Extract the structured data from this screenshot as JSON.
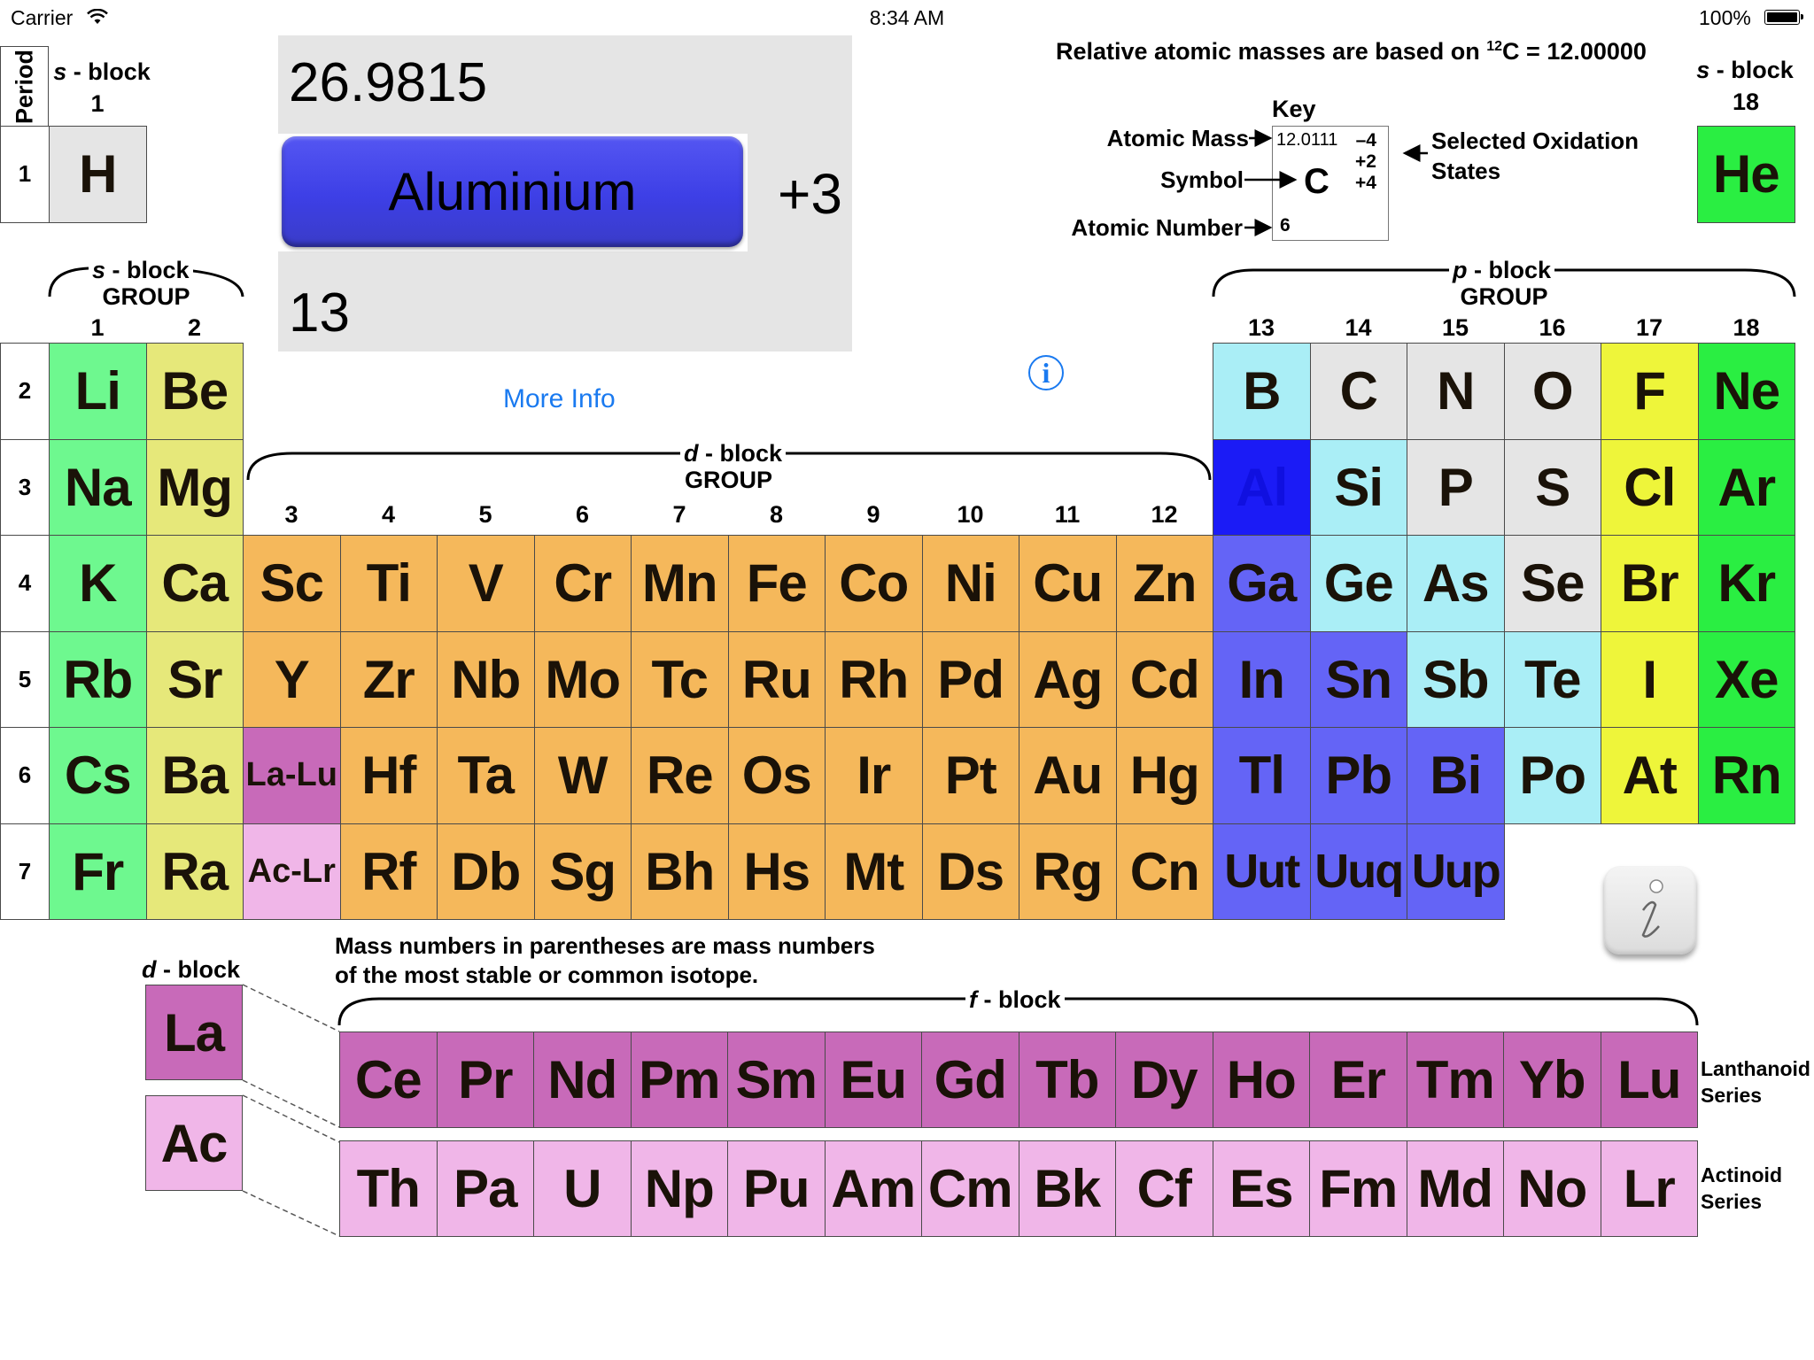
{
  "status_bar": {
    "carrier": "Carrier",
    "time": "8:34 AM",
    "battery": "100%"
  },
  "selected": {
    "atomic_mass": "26.9815",
    "name": "Aluminium",
    "oxidation": "+3",
    "atomic_number": "13",
    "more_info": "More Info"
  },
  "header_note": {
    "prefix": "Relative atomic masses are based on ",
    "sup": "12",
    "suffix": "C = 12.00000"
  },
  "key": {
    "title": "Key",
    "atomic_mass_label": "Atomic Mass",
    "symbol_label": "Symbol",
    "atomic_number_label": "Atomic Number",
    "ox_label_1": "Selected Oxidation",
    "ox_label_2": "States",
    "sample_mass": "12.0111",
    "sample_symbol": "C",
    "sample_number": "6",
    "sample_ox": [
      "–4",
      "+2",
      "+4"
    ]
  },
  "labels": {
    "period": "Period",
    "s_block": "s",
    "block_suffix": " - block",
    "p_block": "p",
    "d_block": "d",
    "f_block": "f",
    "group": "GROUP",
    "group_1": "1",
    "group_18": "18",
    "lanthanoid_1": "Lanthanoid",
    "actinoid_1": "Actinoid",
    "series": "Series",
    "mass_note_1": "Mass numbers in parentheses are mass numbers",
    "mass_note_2": "of the most stable or common isotope."
  },
  "periods": [
    "1",
    "2",
    "3",
    "4",
    "5",
    "6",
    "7"
  ],
  "group_numbers": [
    "1",
    "2",
    "3",
    "4",
    "5",
    "6",
    "7",
    "8",
    "9",
    "10",
    "11",
    "12",
    "13",
    "14",
    "15",
    "16",
    "17",
    "18"
  ],
  "colors": {
    "alkali": "#6ef88f",
    "alkaline": "#e6e87a",
    "transition": "#f5b85b",
    "metal": "#6464f6",
    "metalloid": "#aaeef6",
    "nonmetal": "#e5e5e5",
    "halogen": "#eef53a",
    "noble": "#2aee42",
    "lanthanoid": "#c86ab9",
    "actinoid": "#f0b6e8",
    "selected": "#1b1bf6",
    "hydrogen": "#e5e5e5"
  },
  "elements": [
    {
      "s": "H",
      "g": 1,
      "p": 1,
      "c": "hydrogen"
    },
    {
      "s": "He",
      "g": 18,
      "p": 1,
      "c": "noble"
    },
    {
      "s": "Li",
      "g": 1,
      "p": 2,
      "c": "alkali"
    },
    {
      "s": "Be",
      "g": 2,
      "p": 2,
      "c": "alkaline"
    },
    {
      "s": "B",
      "g": 13,
      "p": 2,
      "c": "metalloid"
    },
    {
      "s": "C",
      "g": 14,
      "p": 2,
      "c": "nonmetal"
    },
    {
      "s": "N",
      "g": 15,
      "p": 2,
      "c": "nonmetal"
    },
    {
      "s": "O",
      "g": 16,
      "p": 2,
      "c": "nonmetal"
    },
    {
      "s": "F",
      "g": 17,
      "p": 2,
      "c": "halogen"
    },
    {
      "s": "Ne",
      "g": 18,
      "p": 2,
      "c": "noble"
    },
    {
      "s": "Na",
      "g": 1,
      "p": 3,
      "c": "alkali"
    },
    {
      "s": "Mg",
      "g": 2,
      "p": 3,
      "c": "alkaline"
    },
    {
      "s": "Al",
      "g": 13,
      "p": 3,
      "c": "selected"
    },
    {
      "s": "Si",
      "g": 14,
      "p": 3,
      "c": "metalloid"
    },
    {
      "s": "P",
      "g": 15,
      "p": 3,
      "c": "nonmetal"
    },
    {
      "s": "S",
      "g": 16,
      "p": 3,
      "c": "nonmetal"
    },
    {
      "s": "Cl",
      "g": 17,
      "p": 3,
      "c": "halogen"
    },
    {
      "s": "Ar",
      "g": 18,
      "p": 3,
      "c": "noble"
    },
    {
      "s": "K",
      "g": 1,
      "p": 4,
      "c": "alkali"
    },
    {
      "s": "Ca",
      "g": 2,
      "p": 4,
      "c": "alkaline"
    },
    {
      "s": "Sc",
      "g": 3,
      "p": 4,
      "c": "transition"
    },
    {
      "s": "Ti",
      "g": 4,
      "p": 4,
      "c": "transition"
    },
    {
      "s": "V",
      "g": 5,
      "p": 4,
      "c": "transition"
    },
    {
      "s": "Cr",
      "g": 6,
      "p": 4,
      "c": "transition"
    },
    {
      "s": "Mn",
      "g": 7,
      "p": 4,
      "c": "transition"
    },
    {
      "s": "Fe",
      "g": 8,
      "p": 4,
      "c": "transition"
    },
    {
      "s": "Co",
      "g": 9,
      "p": 4,
      "c": "transition"
    },
    {
      "s": "Ni",
      "g": 10,
      "p": 4,
      "c": "transition"
    },
    {
      "s": "Cu",
      "g": 11,
      "p": 4,
      "c": "transition"
    },
    {
      "s": "Zn",
      "g": 12,
      "p": 4,
      "c": "transition"
    },
    {
      "s": "Ga",
      "g": 13,
      "p": 4,
      "c": "metal"
    },
    {
      "s": "Ge",
      "g": 14,
      "p": 4,
      "c": "metalloid"
    },
    {
      "s": "As",
      "g": 15,
      "p": 4,
      "c": "metalloid"
    },
    {
      "s": "Se",
      "g": 16,
      "p": 4,
      "c": "nonmetal"
    },
    {
      "s": "Br",
      "g": 17,
      "p": 4,
      "c": "halogen"
    },
    {
      "s": "Kr",
      "g": 18,
      "p": 4,
      "c": "noble"
    },
    {
      "s": "Rb",
      "g": 1,
      "p": 5,
      "c": "alkali"
    },
    {
      "s": "Sr",
      "g": 2,
      "p": 5,
      "c": "alkaline"
    },
    {
      "s": "Y",
      "g": 3,
      "p": 5,
      "c": "transition"
    },
    {
      "s": "Zr",
      "g": 4,
      "p": 5,
      "c": "transition"
    },
    {
      "s": "Nb",
      "g": 5,
      "p": 5,
      "c": "transition"
    },
    {
      "s": "Mo",
      "g": 6,
      "p": 5,
      "c": "transition"
    },
    {
      "s": "Tc",
      "g": 7,
      "p": 5,
      "c": "transition"
    },
    {
      "s": "Ru",
      "g": 8,
      "p": 5,
      "c": "transition"
    },
    {
      "s": "Rh",
      "g": 9,
      "p": 5,
      "c": "transition"
    },
    {
      "s": "Pd",
      "g": 10,
      "p": 5,
      "c": "transition"
    },
    {
      "s": "Ag",
      "g": 11,
      "p": 5,
      "c": "transition"
    },
    {
      "s": "Cd",
      "g": 12,
      "p": 5,
      "c": "transition"
    },
    {
      "s": "In",
      "g": 13,
      "p": 5,
      "c": "metal"
    },
    {
      "s": "Sn",
      "g": 14,
      "p": 5,
      "c": "metal"
    },
    {
      "s": "Sb",
      "g": 15,
      "p": 5,
      "c": "metalloid"
    },
    {
      "s": "Te",
      "g": 16,
      "p": 5,
      "c": "metalloid"
    },
    {
      "s": "I",
      "g": 17,
      "p": 5,
      "c": "halogen"
    },
    {
      "s": "Xe",
      "g": 18,
      "p": 5,
      "c": "noble"
    },
    {
      "s": "Cs",
      "g": 1,
      "p": 6,
      "c": "alkali"
    },
    {
      "s": "Ba",
      "g": 2,
      "p": 6,
      "c": "alkaline"
    },
    {
      "s": "La-Lu",
      "g": 3,
      "p": 6,
      "c": "lanthanoid",
      "small": true
    },
    {
      "s": "Hf",
      "g": 4,
      "p": 6,
      "c": "transition"
    },
    {
      "s": "Ta",
      "g": 5,
      "p": 6,
      "c": "transition"
    },
    {
      "s": "W",
      "g": 6,
      "p": 6,
      "c": "transition"
    },
    {
      "s": "Re",
      "g": 7,
      "p": 6,
      "c": "transition"
    },
    {
      "s": "Os",
      "g": 8,
      "p": 6,
      "c": "transition"
    },
    {
      "s": "Ir",
      "g": 9,
      "p": 6,
      "c": "transition"
    },
    {
      "s": "Pt",
      "g": 10,
      "p": 6,
      "c": "transition"
    },
    {
      "s": "Au",
      "g": 11,
      "p": 6,
      "c": "transition"
    },
    {
      "s": "Hg",
      "g": 12,
      "p": 6,
      "c": "transition"
    },
    {
      "s": "Tl",
      "g": 13,
      "p": 6,
      "c": "metal"
    },
    {
      "s": "Pb",
      "g": 14,
      "p": 6,
      "c": "metal"
    },
    {
      "s": "Bi",
      "g": 15,
      "p": 6,
      "c": "metal"
    },
    {
      "s": "Po",
      "g": 16,
      "p": 6,
      "c": "metalloid"
    },
    {
      "s": "At",
      "g": 17,
      "p": 6,
      "c": "halogen"
    },
    {
      "s": "Rn",
      "g": 18,
      "p": 6,
      "c": "noble"
    },
    {
      "s": "Fr",
      "g": 1,
      "p": 7,
      "c": "alkali"
    },
    {
      "s": "Ra",
      "g": 2,
      "p": 7,
      "c": "alkaline"
    },
    {
      "s": "Ac-Lr",
      "g": 3,
      "p": 7,
      "c": "actinoid",
      "small": true
    },
    {
      "s": "Rf",
      "g": 4,
      "p": 7,
      "c": "transition"
    },
    {
      "s": "Db",
      "g": 5,
      "p": 7,
      "c": "transition"
    },
    {
      "s": "Sg",
      "g": 6,
      "p": 7,
      "c": "transition"
    },
    {
      "s": "Bh",
      "g": 7,
      "p": 7,
      "c": "transition"
    },
    {
      "s": "Hs",
      "g": 8,
      "p": 7,
      "c": "transition"
    },
    {
      "s": "Mt",
      "g": 9,
      "p": 7,
      "c": "transition"
    },
    {
      "s": "Ds",
      "g": 10,
      "p": 7,
      "c": "transition"
    },
    {
      "s": "Rg",
      "g": 11,
      "p": 7,
      "c": "transition"
    },
    {
      "s": "Cn",
      "g": 12,
      "p": 7,
      "c": "transition"
    },
    {
      "s": "Uut",
      "g": 13,
      "p": 7,
      "c": "metal"
    },
    {
      "s": "Uuq",
      "g": 14,
      "p": 7,
      "c": "metal"
    },
    {
      "s": "Uup",
      "g": 15,
      "p": 7,
      "c": "metal"
    }
  ],
  "lanthanoids": [
    "Ce",
    "Pr",
    "Nd",
    "Pm",
    "Sm",
    "Eu",
    "Gd",
    "Tb",
    "Dy",
    "Ho",
    "Er",
    "Tm",
    "Yb",
    "Lu"
  ],
  "actinoids": [
    "Th",
    "Pa",
    "U",
    "Np",
    "Pu",
    "Am",
    "Cm",
    "Bk",
    "Cf",
    "Es",
    "Fm",
    "Md",
    "No",
    "Lr"
  ],
  "f_heads": {
    "la": "La",
    "ac": "Ac"
  }
}
